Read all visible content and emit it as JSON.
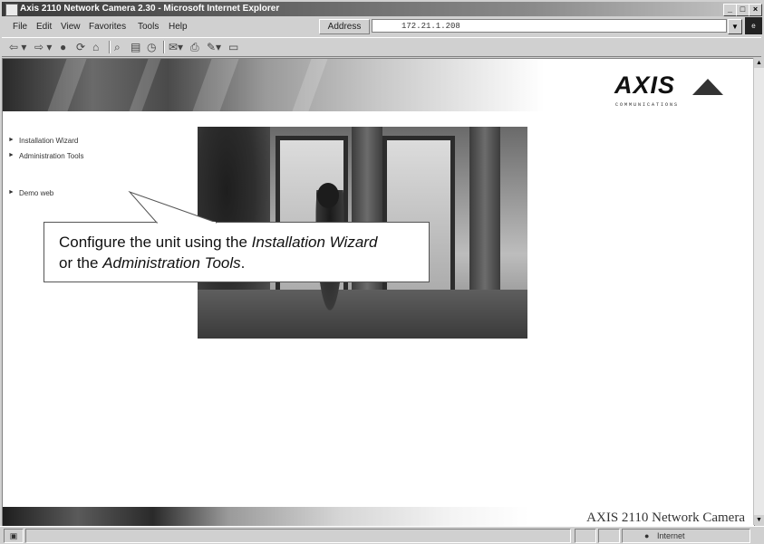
{
  "window": {
    "title": "Axis 2110 Network Camera 2.30 - Microsoft Internet Explorer",
    "minimize_glyph": "_",
    "restore_glyph": "□",
    "close_glyph": "×"
  },
  "menu": [
    "File",
    "Edit",
    "View",
    "Favorites",
    "Tools",
    "Help"
  ],
  "address": {
    "label": "Address",
    "value": "172.21.1.208"
  },
  "page": {
    "logo_text": "AXIS",
    "logo_subtext": "COMMUNICATIONS",
    "links": [
      "Installation Wizard",
      "Administration Tools",
      "Demo web"
    ],
    "callout": {
      "line1_prefix": "Configure the unit using the ",
      "line1_em": "Installation Wizard",
      "line2_prefix": "or the ",
      "line2_em": "Administration Tools",
      "line2_suffix": "."
    },
    "footer_text": "AXIS 2110 Network Camera"
  },
  "status": {
    "zone_text": "Internet"
  },
  "icons": {
    "back": "back-arrow-icon",
    "forward": "forward-arrow-icon",
    "stop": "stop-icon",
    "refresh": "refresh-icon",
    "home": "home-icon",
    "search": "search-icon",
    "favorites": "favorites-icon",
    "history": "history-icon",
    "mail": "mail-icon",
    "print": "print-icon",
    "edit": "edit-icon",
    "discuss": "discuss-icon"
  }
}
